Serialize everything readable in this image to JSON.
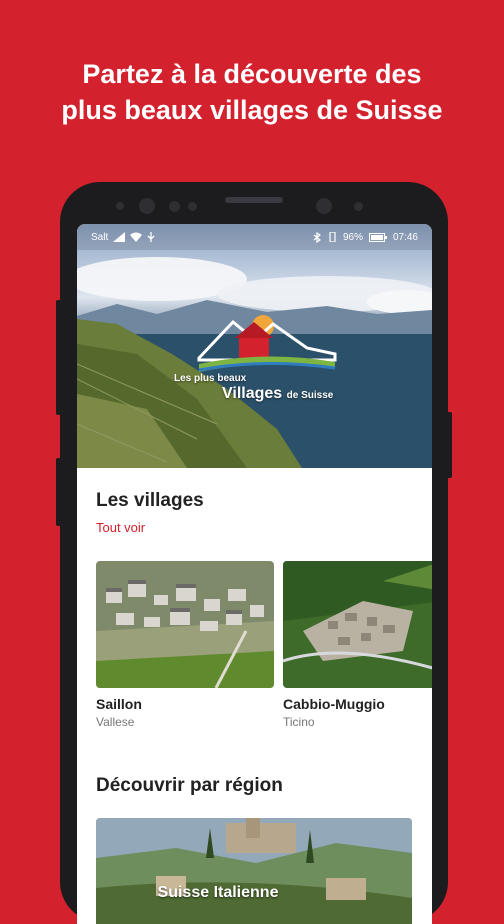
{
  "headline": {
    "line1": "Partez à la découverte des",
    "line2": "plus beaux villages de Suisse"
  },
  "status_bar": {
    "carrier": "Salt",
    "battery": "96%",
    "time": "07:46",
    "icons": [
      "signal-icon",
      "wifi-icon",
      "usb-icon",
      "bluetooth-icon",
      "vibrate-icon",
      "battery-icon"
    ]
  },
  "hero": {
    "logo_line1": "Les plus beaux",
    "logo_line2_a": "Villages",
    "logo_line2_b": "de Suisse"
  },
  "villages_section": {
    "title": "Les villages",
    "see_all": "Tout voir",
    "items": [
      {
        "name": "Saillon",
        "region": "Vallese"
      },
      {
        "name": "Cabbio-Muggio",
        "region": "Ticino"
      }
    ]
  },
  "regions_section": {
    "title": "Découvrir par région",
    "items": [
      {
        "name": "Suisse Italienne"
      }
    ]
  },
  "colors": {
    "brand_red": "#d3212d",
    "phone_body": "#1c1c1e"
  }
}
